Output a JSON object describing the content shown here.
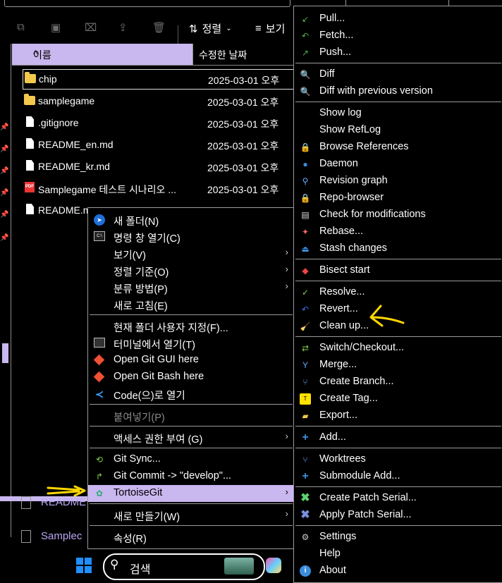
{
  "toolbar": {
    "sort_label": "정렬",
    "view_label": "보기",
    "icons": [
      "copy-icon",
      "paste-icon",
      "rename-icon",
      "share-icon",
      "delete-icon"
    ]
  },
  "columns": {
    "name": "이름",
    "modified": "수정한 날짜"
  },
  "files": [
    {
      "name": "chip",
      "date": "2025-03-01 오후",
      "type": "folder",
      "selected": true
    },
    {
      "name": "samplegame",
      "date": "2025-03-01 오후",
      "type": "folder"
    },
    {
      "name": ".gitignore",
      "date": "2025-03-01 오후",
      "type": "file"
    },
    {
      "name": "README_en.md",
      "date": "2025-03-01 오후",
      "type": "file"
    },
    {
      "name": "README_kr.md",
      "date": "2025-03-01 오후",
      "type": "file"
    },
    {
      "name": "Samplegame 테스트 시나리오 ...",
      "date": "2025-03-01 오후",
      "type": "pdf"
    },
    {
      "name": "README.m",
      "date": "",
      "type": "file"
    }
  ],
  "background_files": {
    "file1": "README",
    "file2": "Samplec"
  },
  "context_menu": {
    "items": [
      {
        "label": "새 폴더(N)",
        "icon": "new-folder-icon"
      },
      {
        "label": "명령 창 열기(C)",
        "icon": "cmd-icon"
      },
      {
        "label": "보기(V)",
        "submenu": true
      },
      {
        "label": "정렬 기준(O)",
        "submenu": true
      },
      {
        "label": "분류 방법(P)",
        "submenu": true
      },
      {
        "label": "새로 고침(E)"
      },
      {
        "label": "현재 폴더 사용자 지정(F)..."
      },
      {
        "label": "터미널에서 열기(T)",
        "icon": "terminal-icon"
      },
      {
        "label": "Open Git GUI here",
        "icon": "git-icon"
      },
      {
        "label": "Open Git Bash here",
        "icon": "git-icon"
      },
      {
        "label": "Code(으)로 열기",
        "icon": "vscode-icon"
      },
      {
        "label": "붙여넣기(P)",
        "disabled": true
      },
      {
        "label": "액세스 권한 부여 (G)",
        "submenu": true
      },
      {
        "label": "Git Sync...",
        "icon": "git-sync-icon"
      },
      {
        "label": "Git Commit -> \"develop\"...",
        "icon": "git-commit-icon"
      },
      {
        "label": "TortoiseGit",
        "icon": "tortoisegit-icon",
        "submenu": true,
        "highlighted": true
      },
      {
        "label": "새로 만들기(W)",
        "submenu": true
      },
      {
        "label": "속성(R)"
      }
    ]
  },
  "tortoise_menu": {
    "items": [
      {
        "label": "Pull...",
        "icon": "pull-icon"
      },
      {
        "label": "Fetch...",
        "icon": "fetch-icon"
      },
      {
        "label": "Push...",
        "icon": "push-icon"
      },
      {
        "label": "Diff",
        "icon": "diff-icon"
      },
      {
        "label": "Diff with previous version",
        "icon": "diff-prev-icon"
      },
      {
        "label": "Show log"
      },
      {
        "label": "Show RefLog"
      },
      {
        "label": "Browse References",
        "icon": "references-icon"
      },
      {
        "label": "Daemon",
        "icon": "daemon-icon"
      },
      {
        "label": "Revision graph",
        "icon": "revision-graph-icon"
      },
      {
        "label": "Repo-browser",
        "icon": "repo-browser-icon"
      },
      {
        "label": "Check for modifications",
        "icon": "check-modifications-icon"
      },
      {
        "label": "Rebase...",
        "icon": "rebase-icon"
      },
      {
        "label": "Stash changes",
        "icon": "stash-icon"
      },
      {
        "label": "Bisect start",
        "icon": "bisect-icon"
      },
      {
        "label": "Resolve...",
        "icon": "resolve-icon"
      },
      {
        "label": "Revert...",
        "icon": "revert-icon"
      },
      {
        "label": "Clean up...",
        "icon": "cleanup-icon"
      },
      {
        "label": "Switch/Checkout...",
        "icon": "switch-icon"
      },
      {
        "label": "Merge...",
        "icon": "merge-icon"
      },
      {
        "label": "Create Branch...",
        "icon": "branch-icon"
      },
      {
        "label": "Create Tag...",
        "icon": "tag-icon"
      },
      {
        "label": "Export...",
        "icon": "export-icon"
      },
      {
        "label": "Add...",
        "icon": "add-icon"
      },
      {
        "label": "Worktrees",
        "icon": "worktrees-icon"
      },
      {
        "label": "Submodule Add...",
        "icon": "submodule-add-icon"
      },
      {
        "label": "Create Patch Serial...",
        "icon": "create-patch-icon"
      },
      {
        "label": "Apply Patch Serial...",
        "icon": "apply-patch-icon"
      },
      {
        "label": "Settings",
        "icon": "settings-icon"
      },
      {
        "label": "Help"
      },
      {
        "label": "About",
        "icon": "about-icon"
      }
    ]
  },
  "taskbar": {
    "search_label": "검색"
  },
  "colors": {
    "accent": "#c9b7f0",
    "annotation": "#ffd700"
  }
}
